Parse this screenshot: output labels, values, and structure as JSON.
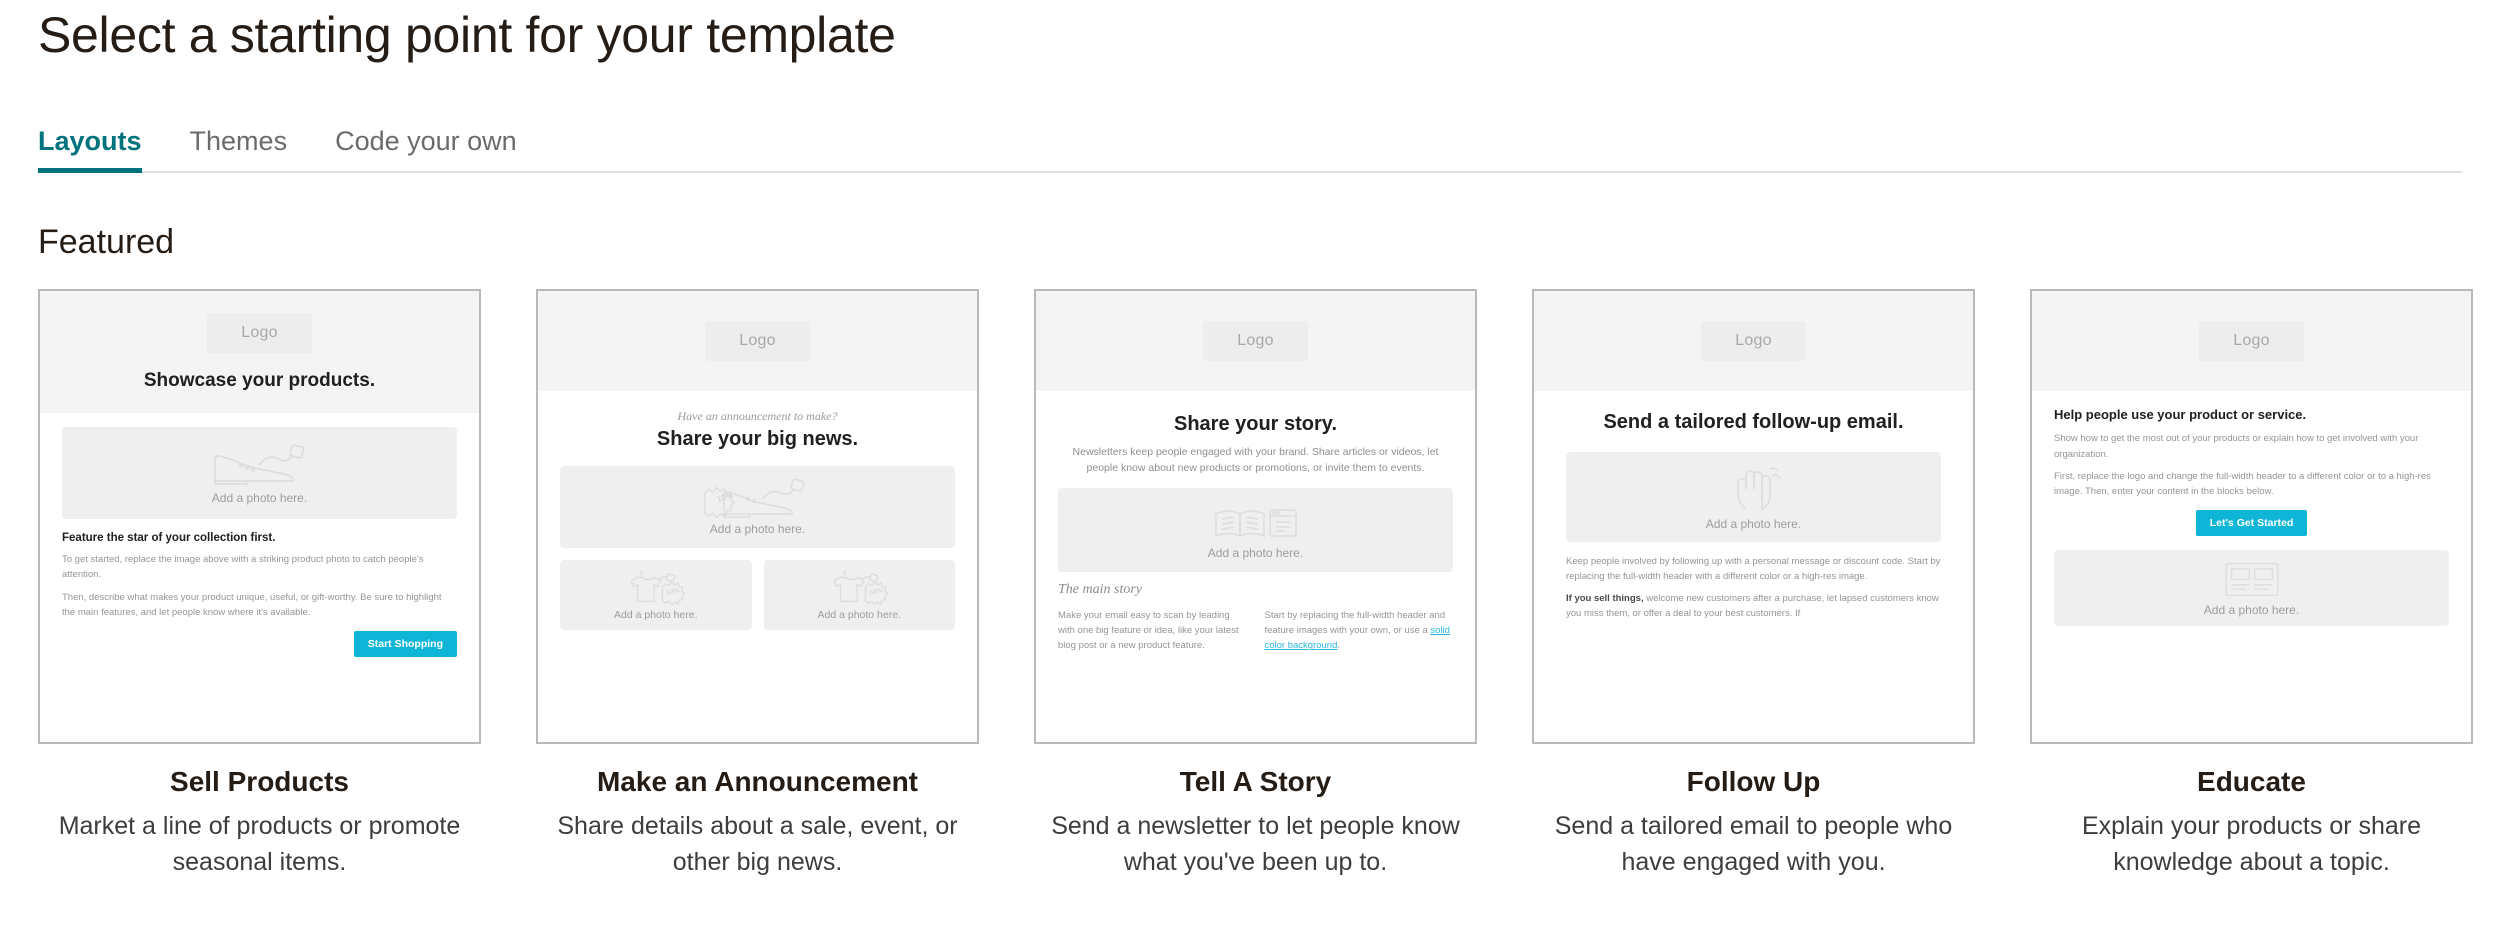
{
  "header": {
    "title": "Select a starting point for your template"
  },
  "tabs": [
    {
      "label": "Layouts",
      "active": true
    },
    {
      "label": "Themes",
      "active": false
    },
    {
      "label": "Code your own",
      "active": false
    }
  ],
  "section": {
    "title": "Featured"
  },
  "colors": {
    "accent_teal": "#00737c",
    "cta_cyan": "#0fb5d6",
    "link_cyan": "#2bb8dd",
    "border_gray": "#b9b9b9",
    "header_band": "#f4f4f4"
  },
  "cards": [
    {
      "name": "Sell Products",
      "desc": "Market a line of products or promote seasonal items.",
      "preview": {
        "logo": "Logo",
        "headline": "Showcase your products.",
        "photo_caption": "Add a photo here.",
        "block_title": "Feature the star of your collection first.",
        "para1": "To get started, replace the image above with a striking product photo to catch people's attention.",
        "para2": "Then, describe what makes your product unique, useful, or gift-worthy. Be sure to highlight the main features, and let people know where it's available.",
        "cta": "Start Shopping"
      }
    },
    {
      "name": "Make an Announcement",
      "desc": "Share details about a sale, event, or other big news.",
      "preview": {
        "logo": "Logo",
        "eyebrow": "Have an announcement to make?",
        "headline": "Share your big news.",
        "photo_caption": "Add a photo here.",
        "photo_caption_left": "Add a photo here.",
        "photo_caption_right": "Add a photo here.",
        "badge_main": "10%",
        "badge_left": "50%",
        "badge_right": "50%"
      }
    },
    {
      "name": "Tell A Story",
      "desc": "Send a newsletter to let people know what you've been up to.",
      "preview": {
        "logo": "Logo",
        "headline": "Share your story.",
        "subhead": "Newsletters keep people engaged with your brand. Share articles or videos, let people know about new products or promotions, or invite them to events.",
        "photo_caption": "Add a photo here.",
        "section_label": "The main story",
        "col1": "Make your email easy to scan by leading with one big feature or idea, like your latest blog post or a new product feature.",
        "col2_pre": "Start by replacing the full-width header and feature images with your own, or use a ",
        "col2_link": "solid color background",
        "col2_post": "."
      }
    },
    {
      "name": "Follow Up",
      "desc": "Send a tailored email to people who have engaged with you.",
      "preview": {
        "logo": "Logo",
        "headline": "Send a tailored follow-up email.",
        "photo_caption": "Add a photo here.",
        "para1": "Keep people involved by following up with a personal message or discount code. Start by replacing the full-width header with a different color or a high-res image.",
        "para2_bold": "If you sell things,",
        "para2": " welcome new customers after a purchase, let lapsed customers know you miss them, or offer a deal to your best customers. If"
      }
    },
    {
      "name": "Educate",
      "desc": "Explain your products or share knowledge about a topic.",
      "preview": {
        "logo": "Logo",
        "headline": "Help people use your product or service.",
        "para1": "Show how to get the most out of your products or explain how to get involved with your organization.",
        "para2": "First, replace the logo and change the full-width header to a different color or to a high-res image. Then, enter your content in the blocks below.",
        "cta": "Let's Get Started",
        "photo_caption": "Add a photo here."
      }
    }
  ]
}
